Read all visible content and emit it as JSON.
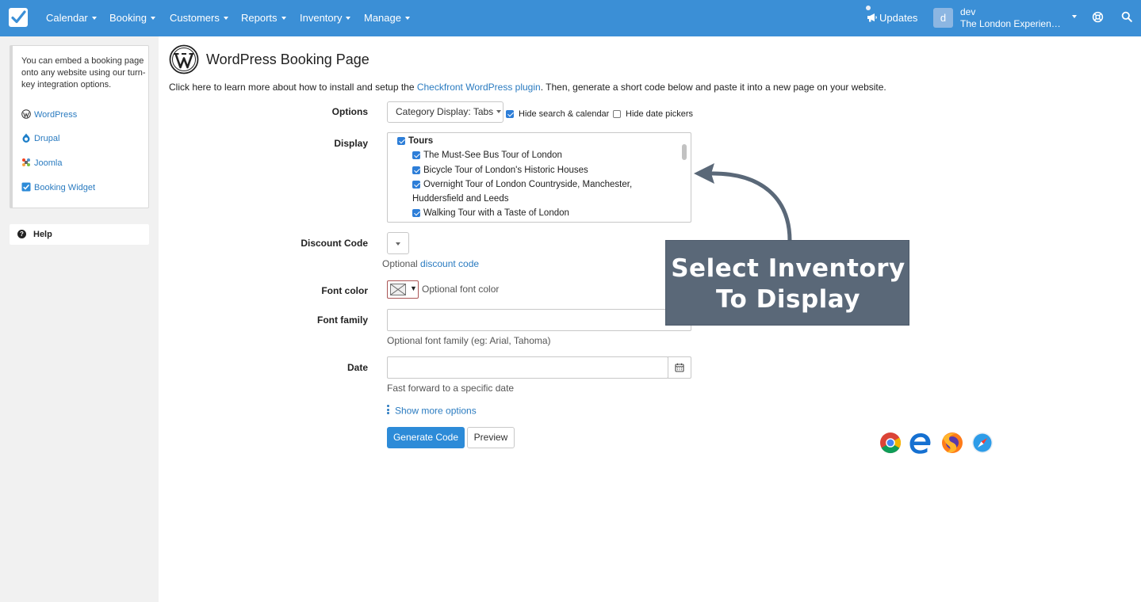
{
  "topnav": {
    "items": [
      {
        "label": "Calendar"
      },
      {
        "label": "Booking"
      },
      {
        "label": "Customers"
      },
      {
        "label": "Reports"
      },
      {
        "label": "Inventory"
      },
      {
        "label": "Manage"
      }
    ],
    "updates_label": "Updates",
    "avatar_letter": "d",
    "user_name": "dev",
    "user_org": "The London Experience Ltd"
  },
  "sidebar": {
    "embed_text": "You can embed a booking page onto any website using our turn-key integration options.",
    "links": [
      {
        "label": "WordPress",
        "icon": "wordpress-icon"
      },
      {
        "label": "Drupal",
        "icon": "drupal-icon"
      },
      {
        "label": "Joomla",
        "icon": "joomla-icon"
      },
      {
        "label": "Booking Widget",
        "icon": "checkmark-icon"
      }
    ],
    "help_label": "Help"
  },
  "main": {
    "title": "WordPress Booking Page",
    "intro_before": "Click here to learn more about how to install and setup the ",
    "intro_link": "Checkfront WordPress plugin",
    "intro_after": ". Then, generate a short code below and paste it into a new page on your website.",
    "options": {
      "label": "Options",
      "dropdown_value": "Category Display: Tabs",
      "hide_search_label": "Hide search & calendar",
      "hide_search_checked": true,
      "hide_pickers_label": "Hide date pickers",
      "hide_pickers_checked": false
    },
    "display": {
      "label": "Display",
      "category": "Tours",
      "items": [
        "The Must-See Bus Tour of London",
        "Bicycle Tour of London's Historic Houses",
        "Overnight Tour of London Countryside, Manchester,",
        "Huddersfield and Leeds",
        "Walking Tour with a Taste of London"
      ]
    },
    "discount": {
      "label": "Discount Code",
      "help_before": "Optional ",
      "help_link": "discount code"
    },
    "font_color": {
      "label": "Font color",
      "help": "Optional font color"
    },
    "font_family": {
      "label": "Font family",
      "value": "",
      "help": "Optional font family (eg: Arial, Tahoma)"
    },
    "date": {
      "label": "Date",
      "value": "",
      "help": "Fast forward to a specific date"
    },
    "show_more_label": "Show more options",
    "generate_label": "Generate Code",
    "preview_label": "Preview"
  },
  "callout": {
    "line1": "Select Inventory",
    "line2": "To Display"
  },
  "colors": {
    "nav_bg": "#3b8fd6",
    "link": "#2a7bc0",
    "primary_button": "#2d8bd8",
    "callout_bg": "#5a6878"
  }
}
